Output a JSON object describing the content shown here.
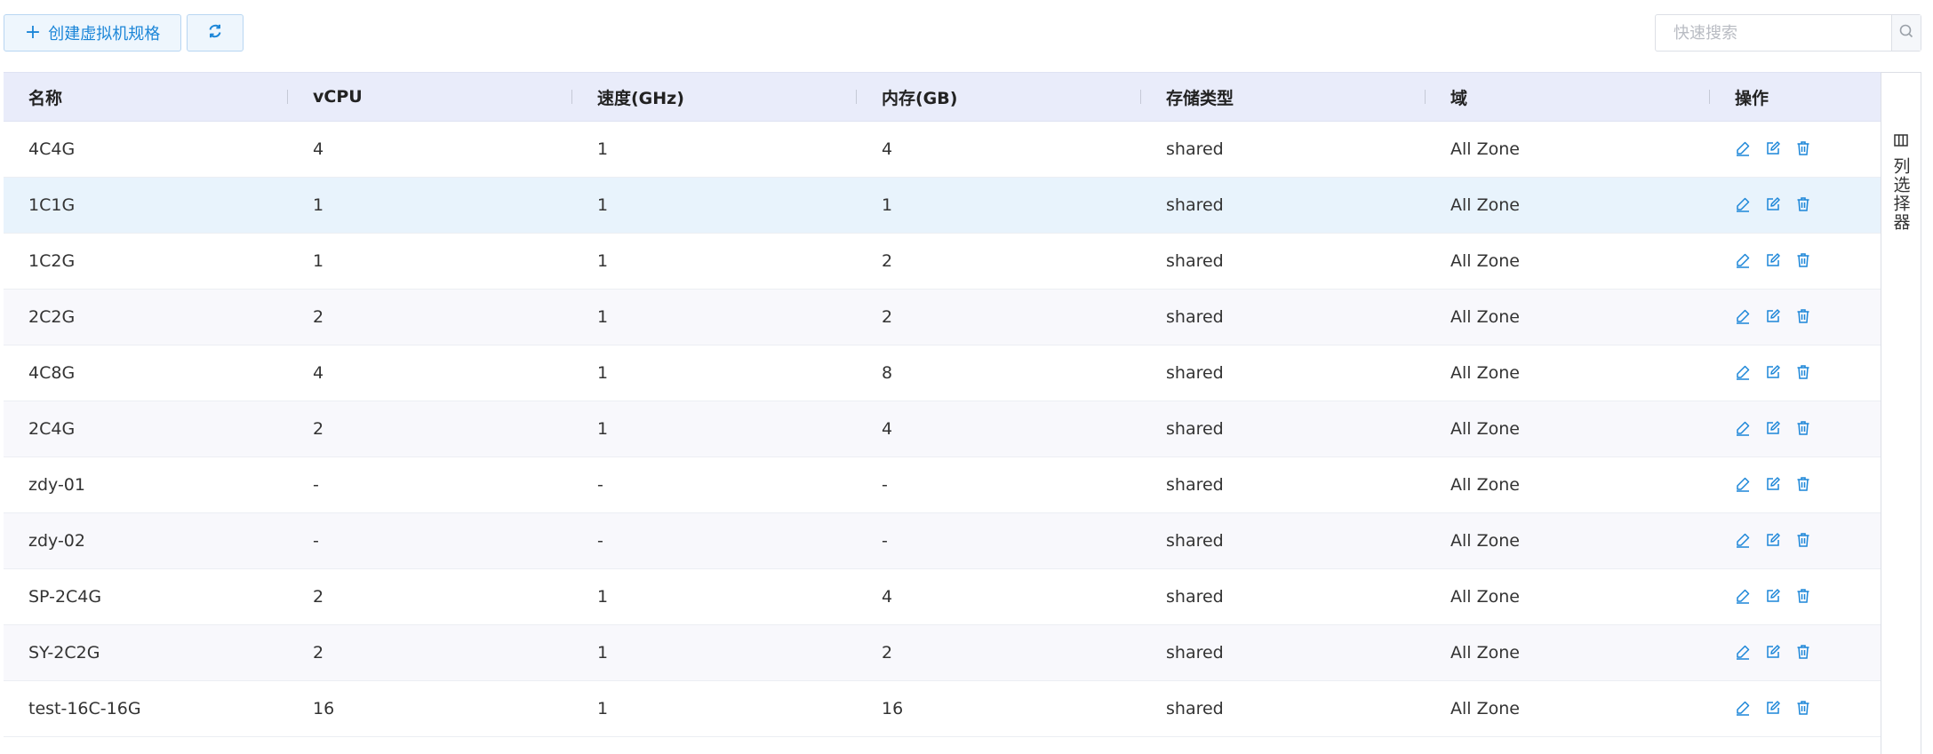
{
  "toolbar": {
    "create_label": "创建虚拟机规格",
    "search_placeholder": "快速搜索"
  },
  "table": {
    "headers": [
      "名称",
      "vCPU",
      "速度(GHz)",
      "内存(GB)",
      "存储类型",
      "域",
      "操作"
    ],
    "rows": [
      {
        "name": "4C4G",
        "vcpu": "4",
        "speed": "1",
        "memory": "4",
        "storage": "shared",
        "zone": "All Zone"
      },
      {
        "name": "1C1G",
        "vcpu": "1",
        "speed": "1",
        "memory": "1",
        "storage": "shared",
        "zone": "All Zone"
      },
      {
        "name": "1C2G",
        "vcpu": "1",
        "speed": "1",
        "memory": "2",
        "storage": "shared",
        "zone": "All Zone"
      },
      {
        "name": "2C2G",
        "vcpu": "2",
        "speed": "1",
        "memory": "2",
        "storage": "shared",
        "zone": "All Zone"
      },
      {
        "name": "4C8G",
        "vcpu": "4",
        "speed": "1",
        "memory": "8",
        "storage": "shared",
        "zone": "All Zone"
      },
      {
        "name": "2C4G",
        "vcpu": "2",
        "speed": "1",
        "memory": "4",
        "storage": "shared",
        "zone": "All Zone"
      },
      {
        "name": "zdy-01",
        "vcpu": "-",
        "speed": "-",
        "memory": "-",
        "storage": "shared",
        "zone": "All Zone"
      },
      {
        "name": "zdy-02",
        "vcpu": "-",
        "speed": "-",
        "memory": "-",
        "storage": "shared",
        "zone": "All Zone"
      },
      {
        "name": "SP-2C4G",
        "vcpu": "2",
        "speed": "1",
        "memory": "4",
        "storage": "shared",
        "zone": "All Zone"
      },
      {
        "name": "SY-2C2G",
        "vcpu": "2",
        "speed": "1",
        "memory": "2",
        "storage": "shared",
        "zone": "All Zone"
      },
      {
        "name": "test-16C-16G",
        "vcpu": "16",
        "speed": "1",
        "memory": "16",
        "storage": "shared",
        "zone": "All Zone"
      }
    ],
    "hover_row": 1
  },
  "column_picker": {
    "label": "列选择器"
  },
  "icons": {
    "create": "plus-icon",
    "refresh": "refresh-icon",
    "search": "search-icon",
    "row_actions": [
      "edit-pen-icon",
      "edit-square-icon",
      "trash-icon"
    ],
    "column_picker": "columns-icon"
  },
  "colors": {
    "accent": "#1c86d8",
    "header_bg": "#e9ecfa",
    "hover_row_bg": "#e8f3fc"
  }
}
